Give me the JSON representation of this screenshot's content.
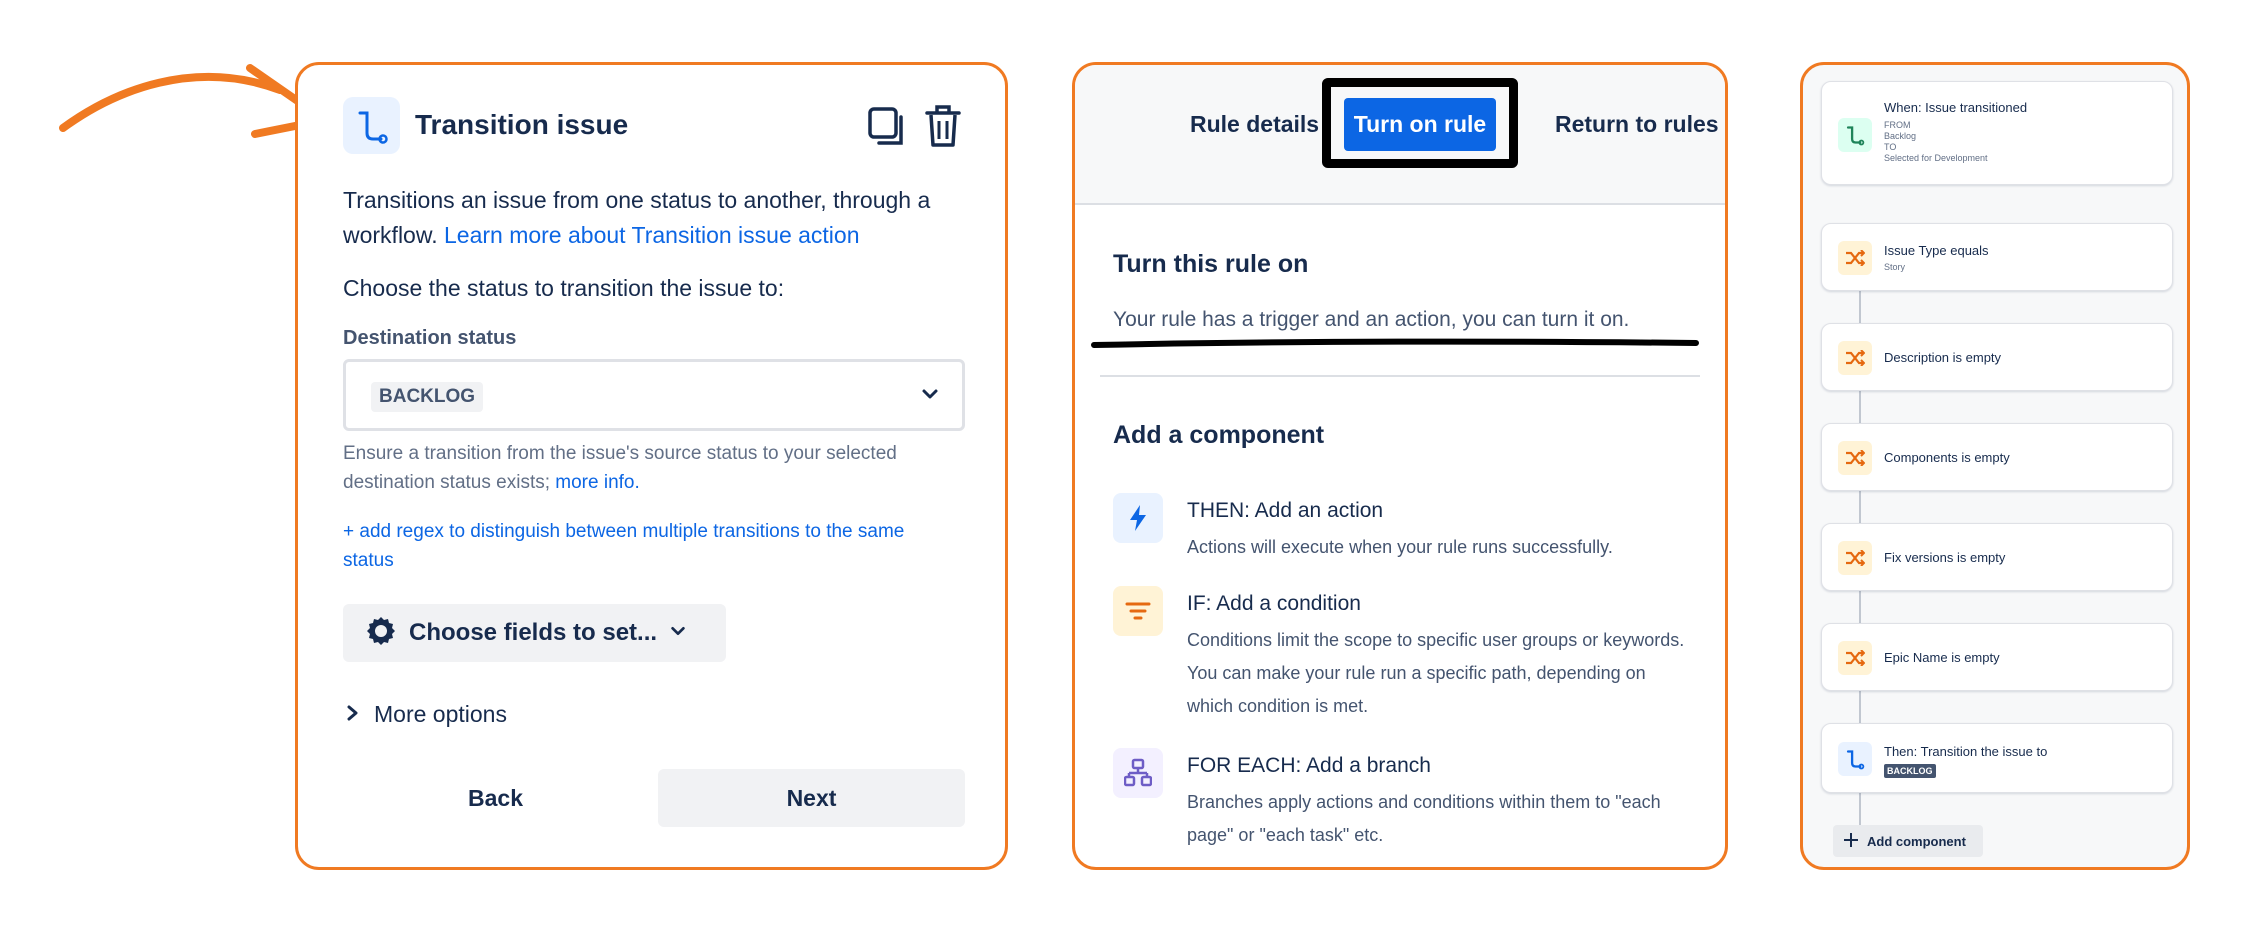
{
  "transition_panel": {
    "title": "Transition issue",
    "description": "Transitions an issue from one status to another, through a workflow.",
    "learn_more_link": "Learn more about Transition issue action",
    "choose_status_prompt": "Choose the status to transition the issue to:",
    "destination_label": "Destination status",
    "destination_value": "BACKLOG",
    "helper_text": "Ensure a transition from the issue's source status to your selected destination status exists;",
    "helper_link": "more info.",
    "regex_link": "+ add regex to distinguish between multiple transitions to the same status",
    "choose_fields_label": "Choose fields to set...",
    "more_options_label": "More options",
    "back_label": "Back",
    "next_label": "Next",
    "icons": [
      "transition-icon",
      "copy-icon",
      "trash-icon",
      "chevron-down-icon",
      "gear-icon",
      "chevron-right-icon"
    ]
  },
  "rule_panel": {
    "rule_details_label": "Rule details",
    "turn_on_label": "Turn on rule",
    "return_label": "Return to rules",
    "turn_on_heading": "Turn this rule on",
    "trigger_message": "Your rule has a trigger and an action, you can turn it on.",
    "add_component_heading": "Add a component",
    "components": [
      {
        "title": "THEN: Add an action",
        "description": "Actions will execute when your rule runs successfully.",
        "icon": "lightning-icon",
        "color": "#0c66e4",
        "bg": "#e9f2ff"
      },
      {
        "title": "IF: Add a condition",
        "description": "Conditions limit the scope to specific user groups or keywords. You can make your rule run a specific path, depending on which condition is met.",
        "icon": "filter-icon",
        "color": "#e56910",
        "bg": "#fff3d6"
      },
      {
        "title": "FOR EACH: Add a branch",
        "description": "Branches apply actions and conditions within them to \"each page\" or \"each task\" etc.",
        "icon": "branch-icon",
        "color": "#6e5dc6",
        "bg": "#f3f0ff"
      }
    ],
    "primary_color": "#0c66e4"
  },
  "flow_panel": {
    "trigger": {
      "title": "When: Issue transitioned",
      "from_label": "FROM",
      "from_value": "Backlog",
      "to_label": "TO",
      "to_value": "Selected for Development",
      "icon": "transition-icon"
    },
    "conditions": [
      {
        "title": "Issue Type equals",
        "subtitle": "Story",
        "icon": "shuffle-icon"
      },
      {
        "title": "Description is empty",
        "icon": "shuffle-icon"
      },
      {
        "title": "Components is empty",
        "icon": "shuffle-icon"
      },
      {
        "title": "Fix versions is empty",
        "icon": "shuffle-icon"
      },
      {
        "title": "Epic Name is empty",
        "icon": "shuffle-icon"
      }
    ],
    "action": {
      "title": "Then: Transition the issue to",
      "tag": "BACKLOG",
      "icon": "transition-icon"
    },
    "add_component_label": "Add component"
  },
  "accent_color": "#f07a22"
}
